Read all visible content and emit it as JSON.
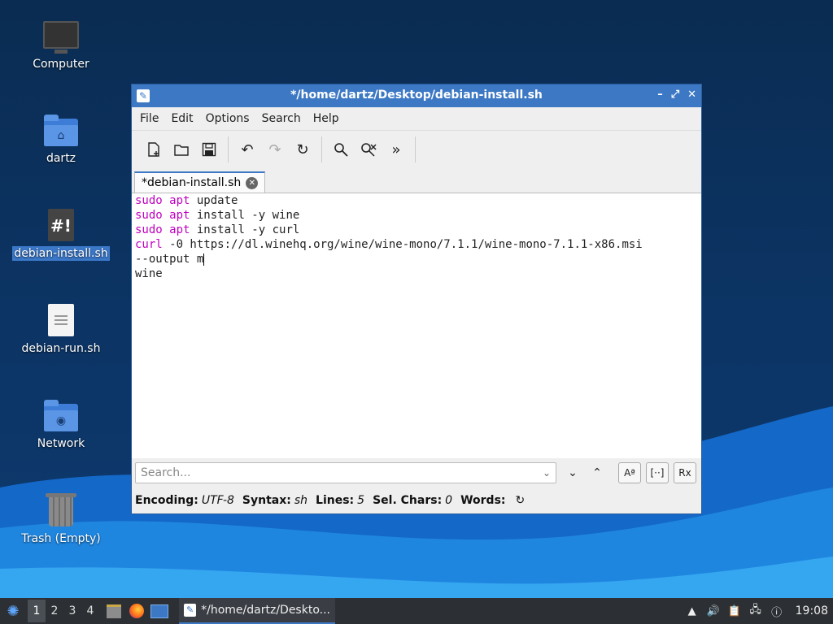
{
  "desktop": {
    "icons": [
      {
        "label": "Computer"
      },
      {
        "label": "dartz"
      },
      {
        "label": "debian-install.sh"
      },
      {
        "label": "debian-run.sh"
      },
      {
        "label": "Network"
      },
      {
        "label": "Trash (Empty)"
      }
    ]
  },
  "window": {
    "title": "*/home/dartz/Desktop/debian-install.sh",
    "controls": {
      "minimize": "–",
      "maximize": "⤢",
      "close": "✕"
    },
    "menu": [
      "File",
      "Edit",
      "Options",
      "Search",
      "Help"
    ],
    "tab": {
      "label": "*debian-install.sh",
      "close": "✕"
    },
    "editor_lines": [
      {
        "kw1": "sudo",
        "kw2": "apt",
        "rest": " update"
      },
      {
        "kw1": "sudo",
        "kw2": "apt",
        "rest": " install -y wine"
      },
      {
        "kw1": "sudo",
        "kw2": "apt",
        "rest": " install -y curl"
      },
      {
        "kw1": "curl",
        "kw2": "",
        "rest": " -0 https://dl.winehq.org/wine/wine-mono/7.1.1/wine-mono-7.1.1-x86.msi"
      },
      {
        "kw1": "",
        "kw2": "",
        "rest": "--output m"
      },
      {
        "kw1": "",
        "kw2": "",
        "rest": "wine"
      }
    ],
    "search": {
      "placeholder": "Search...",
      "case_btn": "Aª",
      "word_btn": "[··]",
      "regex_btn": "Rx"
    },
    "status": {
      "encoding_label": "Encoding:",
      "encoding_value": "UTF-8",
      "syntax_label": "Syntax:",
      "syntax_value": "sh",
      "lines_label": "Lines:",
      "lines_value": "5",
      "sel_label": "Sel. Chars:",
      "sel_value": "0",
      "words_label": "Words:"
    }
  },
  "taskbar": {
    "workspaces": [
      "1",
      "2",
      "3",
      "4"
    ],
    "active_app": "*/home/dartz/Deskto...",
    "clock": "19:08"
  }
}
